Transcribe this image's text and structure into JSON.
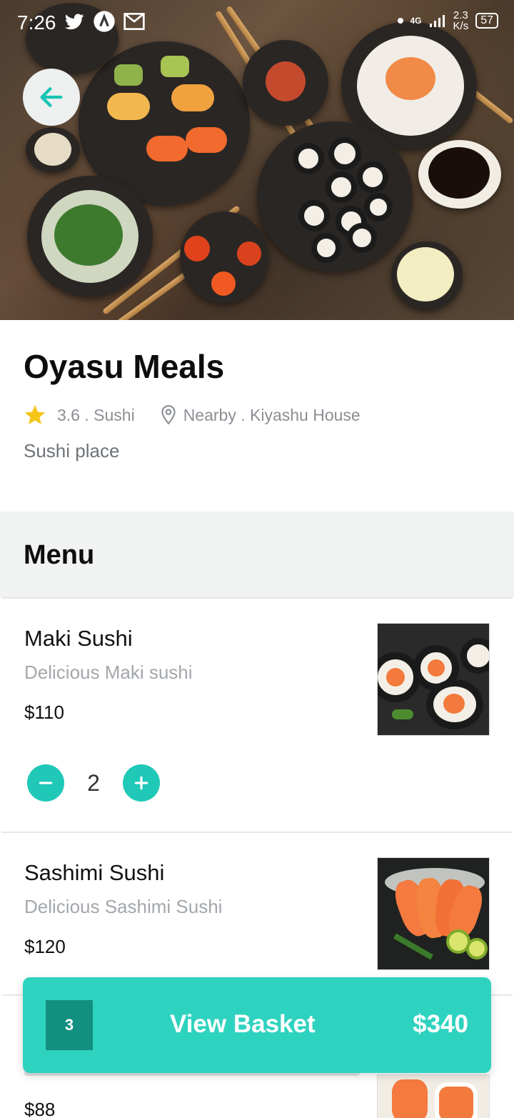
{
  "status_bar": {
    "time": "7:26",
    "network_speed": "2.3",
    "network_unit": "K/s",
    "network_type": "4G",
    "battery": "57"
  },
  "restaurant": {
    "name": "Oyasu Meals",
    "rating_category": "3.6 . Sushi",
    "location": "Nearby . Kiyashu House",
    "description": "Sushi place"
  },
  "menu": {
    "header": "Menu",
    "items": [
      {
        "name": "Maki Sushi",
        "description": "Delicious Maki sushi",
        "price": "$110",
        "quantity": "2"
      },
      {
        "name": "Sashimi Sushi",
        "description": "Delicious Sashimi Sushi",
        "price": "$120"
      },
      {
        "price": "$88"
      }
    ]
  },
  "basket": {
    "count": "3",
    "label": "View Basket",
    "total": "$340"
  },
  "colors": {
    "accent": "#2ed3bf",
    "accent_dark": "#128f81",
    "star": "#f5c518"
  }
}
